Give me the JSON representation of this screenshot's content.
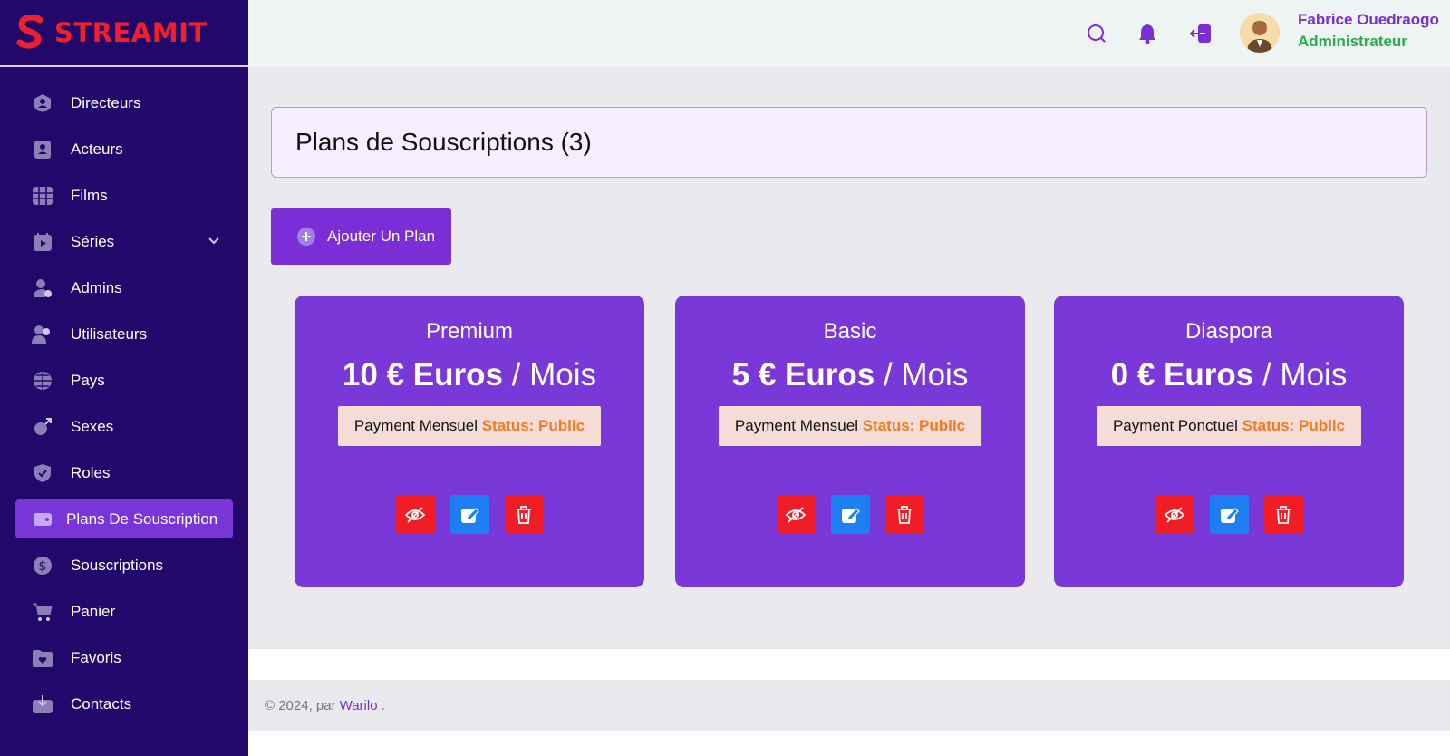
{
  "brand": {
    "name": "STREAMIT",
    "logo_letter": "S",
    "color": "#ef1f2e"
  },
  "sidebar": {
    "items": [
      {
        "label": "Directeurs",
        "icon": "director-icon"
      },
      {
        "label": "Acteurs",
        "icon": "actor-icon"
      },
      {
        "label": "Films",
        "icon": "film-icon"
      },
      {
        "label": "Séries",
        "icon": "series-icon",
        "has_submenu": true
      },
      {
        "label": "Admins",
        "icon": "admin-icon"
      },
      {
        "label": "Utilisateurs",
        "icon": "users-icon"
      },
      {
        "label": "Pays",
        "icon": "globe-icon"
      },
      {
        "label": "Sexes",
        "icon": "gender-icon"
      },
      {
        "label": "Roles",
        "icon": "shield-icon"
      },
      {
        "label": "Plans De Souscription",
        "icon": "wallet-icon",
        "active": true
      },
      {
        "label": "Souscriptions",
        "icon": "dollar-icon"
      },
      {
        "label": "Panier",
        "icon": "cart-icon"
      },
      {
        "label": "Favoris",
        "icon": "favorites-icon"
      },
      {
        "label": "Contacts",
        "icon": "inbox-icon"
      }
    ]
  },
  "header": {
    "user_name": "Fabrice Ouedraogo",
    "user_role": "Administrateur",
    "icons": [
      "search-icon",
      "bell-icon",
      "logout-icon"
    ]
  },
  "main": {
    "title": "Plans de Souscriptions (3)",
    "add_button_label": "Ajouter Un Plan",
    "plans": [
      {
        "name": "Premium",
        "amount": "10 € Euros",
        "period": "/ Mois",
        "payment": "Payment Mensuel",
        "status": "Status: Public"
      },
      {
        "name": "Basic",
        "amount": "5 € Euros",
        "period": "/ Mois",
        "payment": "Payment Mensuel",
        "status": "Status: Public"
      },
      {
        "name": "Diaspora",
        "amount": "0 € Euros",
        "period": "/ Mois",
        "payment": "Payment Ponctuel",
        "status": "Status: Public"
      }
    ]
  },
  "footer": {
    "prefix": "© 2024, par",
    "link": "Warilo",
    "suffix": "."
  },
  "colors": {
    "sidebar_bg": "#22086a",
    "accent": "#7b2ed6",
    "card_bg": "#7b38d8",
    "status": "#f47a1f",
    "danger": "#f01d25",
    "edit": "#1e7ef4",
    "role": "#2bab4d"
  }
}
